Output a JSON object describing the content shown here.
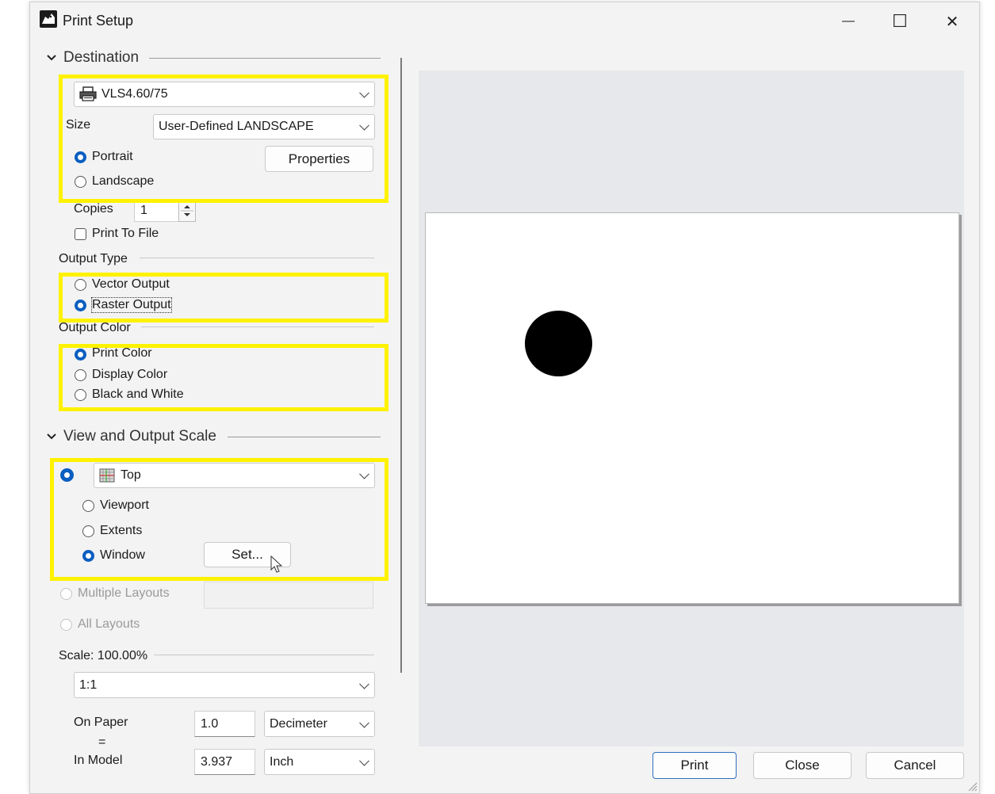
{
  "window": {
    "title": "Print Setup",
    "minimize": "—",
    "maximize": "☐",
    "close": "✕"
  },
  "destination": {
    "header": "Destination",
    "printer": "VLS4.60/75",
    "size_label": "Size",
    "size_value": "User-Defined LANDSCAPE",
    "portrait": "Portrait",
    "landscape": "Landscape",
    "properties": "Properties",
    "orientation_selected": "Portrait",
    "copies_label": "Copies",
    "copies_value": "1",
    "print_to_file": "Print To File",
    "print_to_file_checked": false
  },
  "output_type": {
    "header": "Output Type",
    "vector": "Vector Output",
    "raster": "Raster Output",
    "selected": "Raster Output"
  },
  "output_color": {
    "header": "Output Color",
    "print_color": "Print Color",
    "display_color": "Display Color",
    "bw": "Black and White",
    "selected": "Print Color"
  },
  "view_scale": {
    "header": "View and Output Scale",
    "view": "Top",
    "viewport": "Viewport",
    "extents": "Extents",
    "window": "Window",
    "set_button": "Set...",
    "area_selected": "Window",
    "multiple_layouts": "Multiple Layouts",
    "all_layouts": "All Layouts",
    "scale_label": "Scale:  100.00%",
    "scale_value": "1:1",
    "on_paper_label": "On Paper",
    "equals": "=",
    "in_model_label": "In Model",
    "on_paper_value": "1.0",
    "on_paper_unit": "Decimeter",
    "in_model_value": "3.937",
    "in_model_unit": "Inch"
  },
  "buttons": {
    "print": "Print",
    "close": "Close",
    "cancel": "Cancel"
  },
  "colors": {
    "highlight": "#fff200",
    "accent": "#0a5ec0",
    "preview_bg": "#e6e8eb"
  }
}
